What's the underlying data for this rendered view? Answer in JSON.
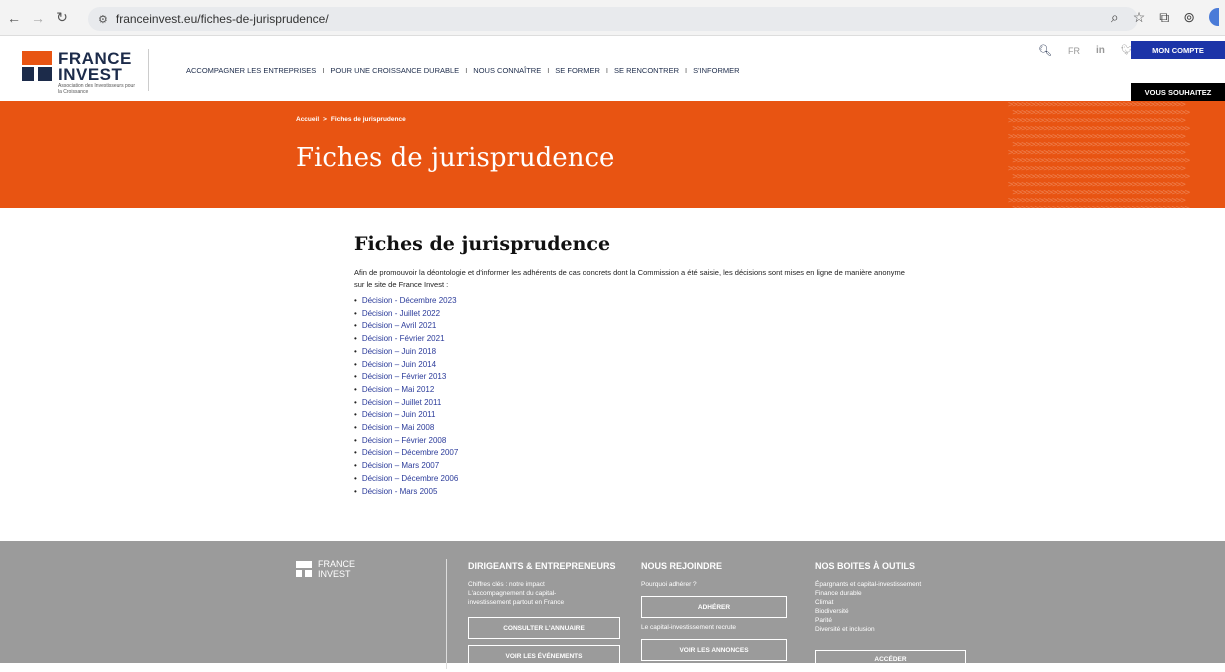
{
  "browser": {
    "url": "franceinvest.eu/fiches-de-jurisprudence/",
    "icons": [
      "back-icon",
      "forward-icon",
      "reload-icon",
      "site-info-icon",
      "zoom-icon",
      "star-icon",
      "extensions-icon",
      "tab-search-icon"
    ]
  },
  "header": {
    "logo_line1": "FRANCE",
    "logo_line2": "INVEST",
    "logo_sub": "Association des Investisseurs pour la Croissance",
    "nav": [
      "ACCOMPAGNER LES ENTREPRISES",
      "POUR UNE CROISSANCE DURABLE",
      "NOUS CONNAÎTRE",
      "SE FORMER",
      "SE RENCONTRER",
      "S'INFORMER"
    ],
    "nav_separator": "I",
    "lang": "FR",
    "linkedin": "in",
    "account_button": "MON COMPTE",
    "wish_button": "VOUS SOUHAITEZ"
  },
  "hero": {
    "breadcrumb_home": "Accueil",
    "breadcrumb_sep": ">",
    "breadcrumb_current": "Fiches de jurisprudence",
    "title": "Fiches de jurisprudence",
    "accent": "#e85412"
  },
  "content": {
    "heading": "Fiches de jurisprudence",
    "intro": "Afin de promouvoir la déontologie et d'informer les adhérents de cas concrets dont la Commission a été saisie, les décisions sont mises en ligne de manière anonyme sur le site de France Invest :",
    "decisions": [
      "Décision - Décembre 2023",
      "Décision - Juillet 2022",
      "Décision – Avril 2021",
      "Décision - Février 2021",
      "Décision – Juin 2018",
      "Décision – Juin 2014",
      "Décision – Février 2013",
      "Décision – Mai 2012",
      "Décision – Juillet 2011",
      "Décision – Juin 2011",
      "Décision – Mai 2008",
      "Décision – Février 2008",
      "Décision – Décembre 2007",
      "Décision – Mars 2007",
      "Décision – Décembre 2006",
      "Décision - Mars 2005"
    ]
  },
  "footer": {
    "logo_line1": "FRANCE",
    "logo_line2": "INVEST",
    "col1": {
      "title": "DIRIGEANTS & ENTREPRENEURS",
      "links": [
        "Chiffres clés : notre impact",
        "L'accompagnement du capital-",
        "investissement partout en France"
      ],
      "btn1": "CONSULTER L'ANNUAIRE",
      "btn2": "VOIR LES ÉVÉNEMENTS"
    },
    "col2": {
      "title": "NOUS REJOINDRE",
      "link1": "Pourquoi adhérer ?",
      "btn1": "ADHÉRER",
      "link2": "Le capital-investissement recrute",
      "btn2": "VOIR LES ANNONCES"
    },
    "col3": {
      "title": "NOS BOITES À OUTILS",
      "links": [
        "Épargnants et capital-investissement",
        "Finance durable",
        "Climat",
        "Biodiversité",
        "Parité",
        "Diversité et inclusion"
      ],
      "btn": "ACCÉDER"
    }
  }
}
